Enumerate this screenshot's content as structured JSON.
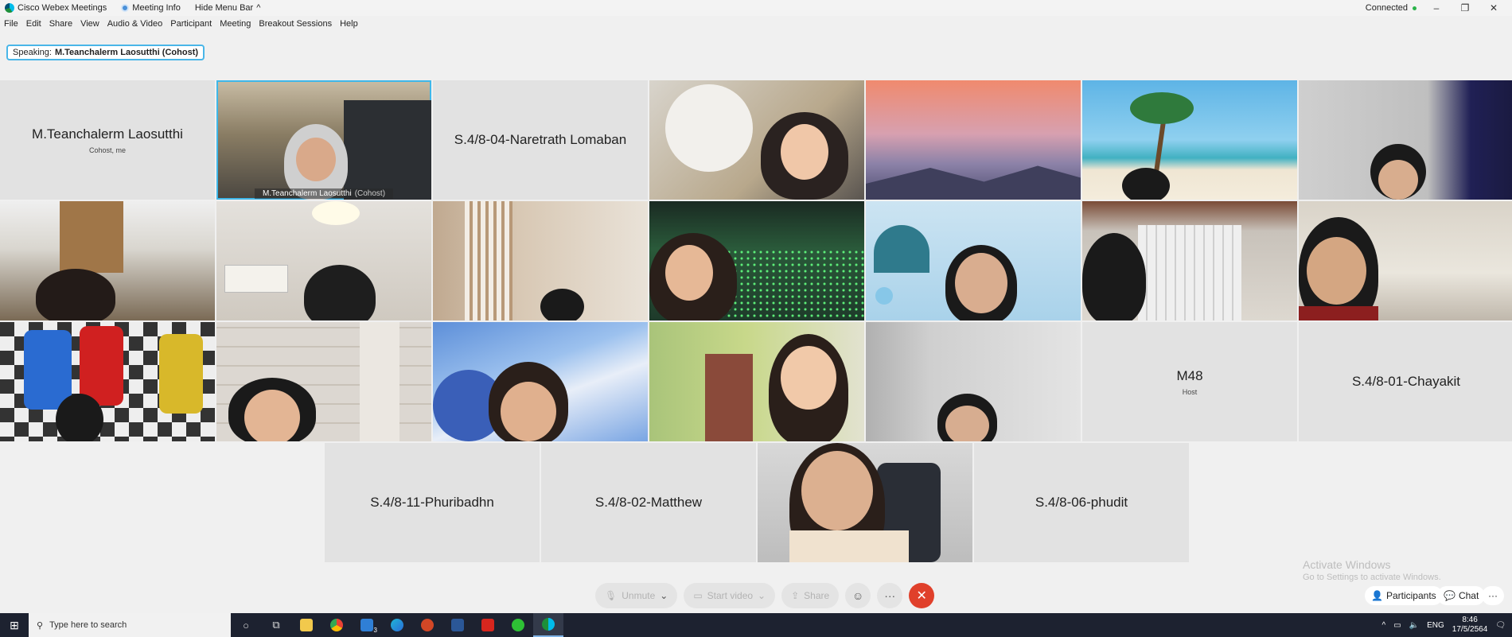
{
  "titlebar": {
    "app_title": "Cisco Webex Meetings",
    "meeting_info": "Meeting Info",
    "hide_menu": "Hide Menu Bar",
    "status": "Connected"
  },
  "menu": [
    "File",
    "Edit",
    "Share",
    "View",
    "Audio & Video",
    "Participant",
    "Meeting",
    "Breakout Sessions",
    "Help"
  ],
  "speaking": {
    "label": "Speaking:",
    "name": "M.Teanchalerm Laosutthi (Cohost)"
  },
  "tiles": {
    "t1": {
      "name": "M.Teanchalerm Laosutthi",
      "sub": "Cohost, me"
    },
    "t2": {
      "caption": "M.Teanchalerm Laosutthi",
      "role": "(Cohost)"
    },
    "t3": {
      "name": "S.4/8-04-Naretrath Lomaban"
    },
    "m48": {
      "name": "M48",
      "sub": "Host"
    },
    "chayakit": {
      "name": "S.4/8-01-Chayakit"
    },
    "phuribadhn": {
      "name": "S.4/8-11-Phuribadhn"
    },
    "matthew": {
      "name": "S.4/8-02-Matthew"
    },
    "phudit": {
      "name": "S.4/8-06-phudit"
    }
  },
  "controls": {
    "unmute": "Unmute",
    "start_video": "Start video",
    "share": "Share",
    "participants": "Participants",
    "chat": "Chat"
  },
  "watermark": {
    "title": "Activate Windows",
    "sub": "Go to Settings to activate Windows."
  },
  "taskbar": {
    "search_placeholder": "Type here to search",
    "lang": "ENG",
    "time": "8:46",
    "date": "17/5/2564",
    "mail_badge": "3"
  },
  "colors": {
    "accent": "#3fb7e9",
    "end_call": "#e0402b",
    "taskbar": "#1d2230"
  }
}
